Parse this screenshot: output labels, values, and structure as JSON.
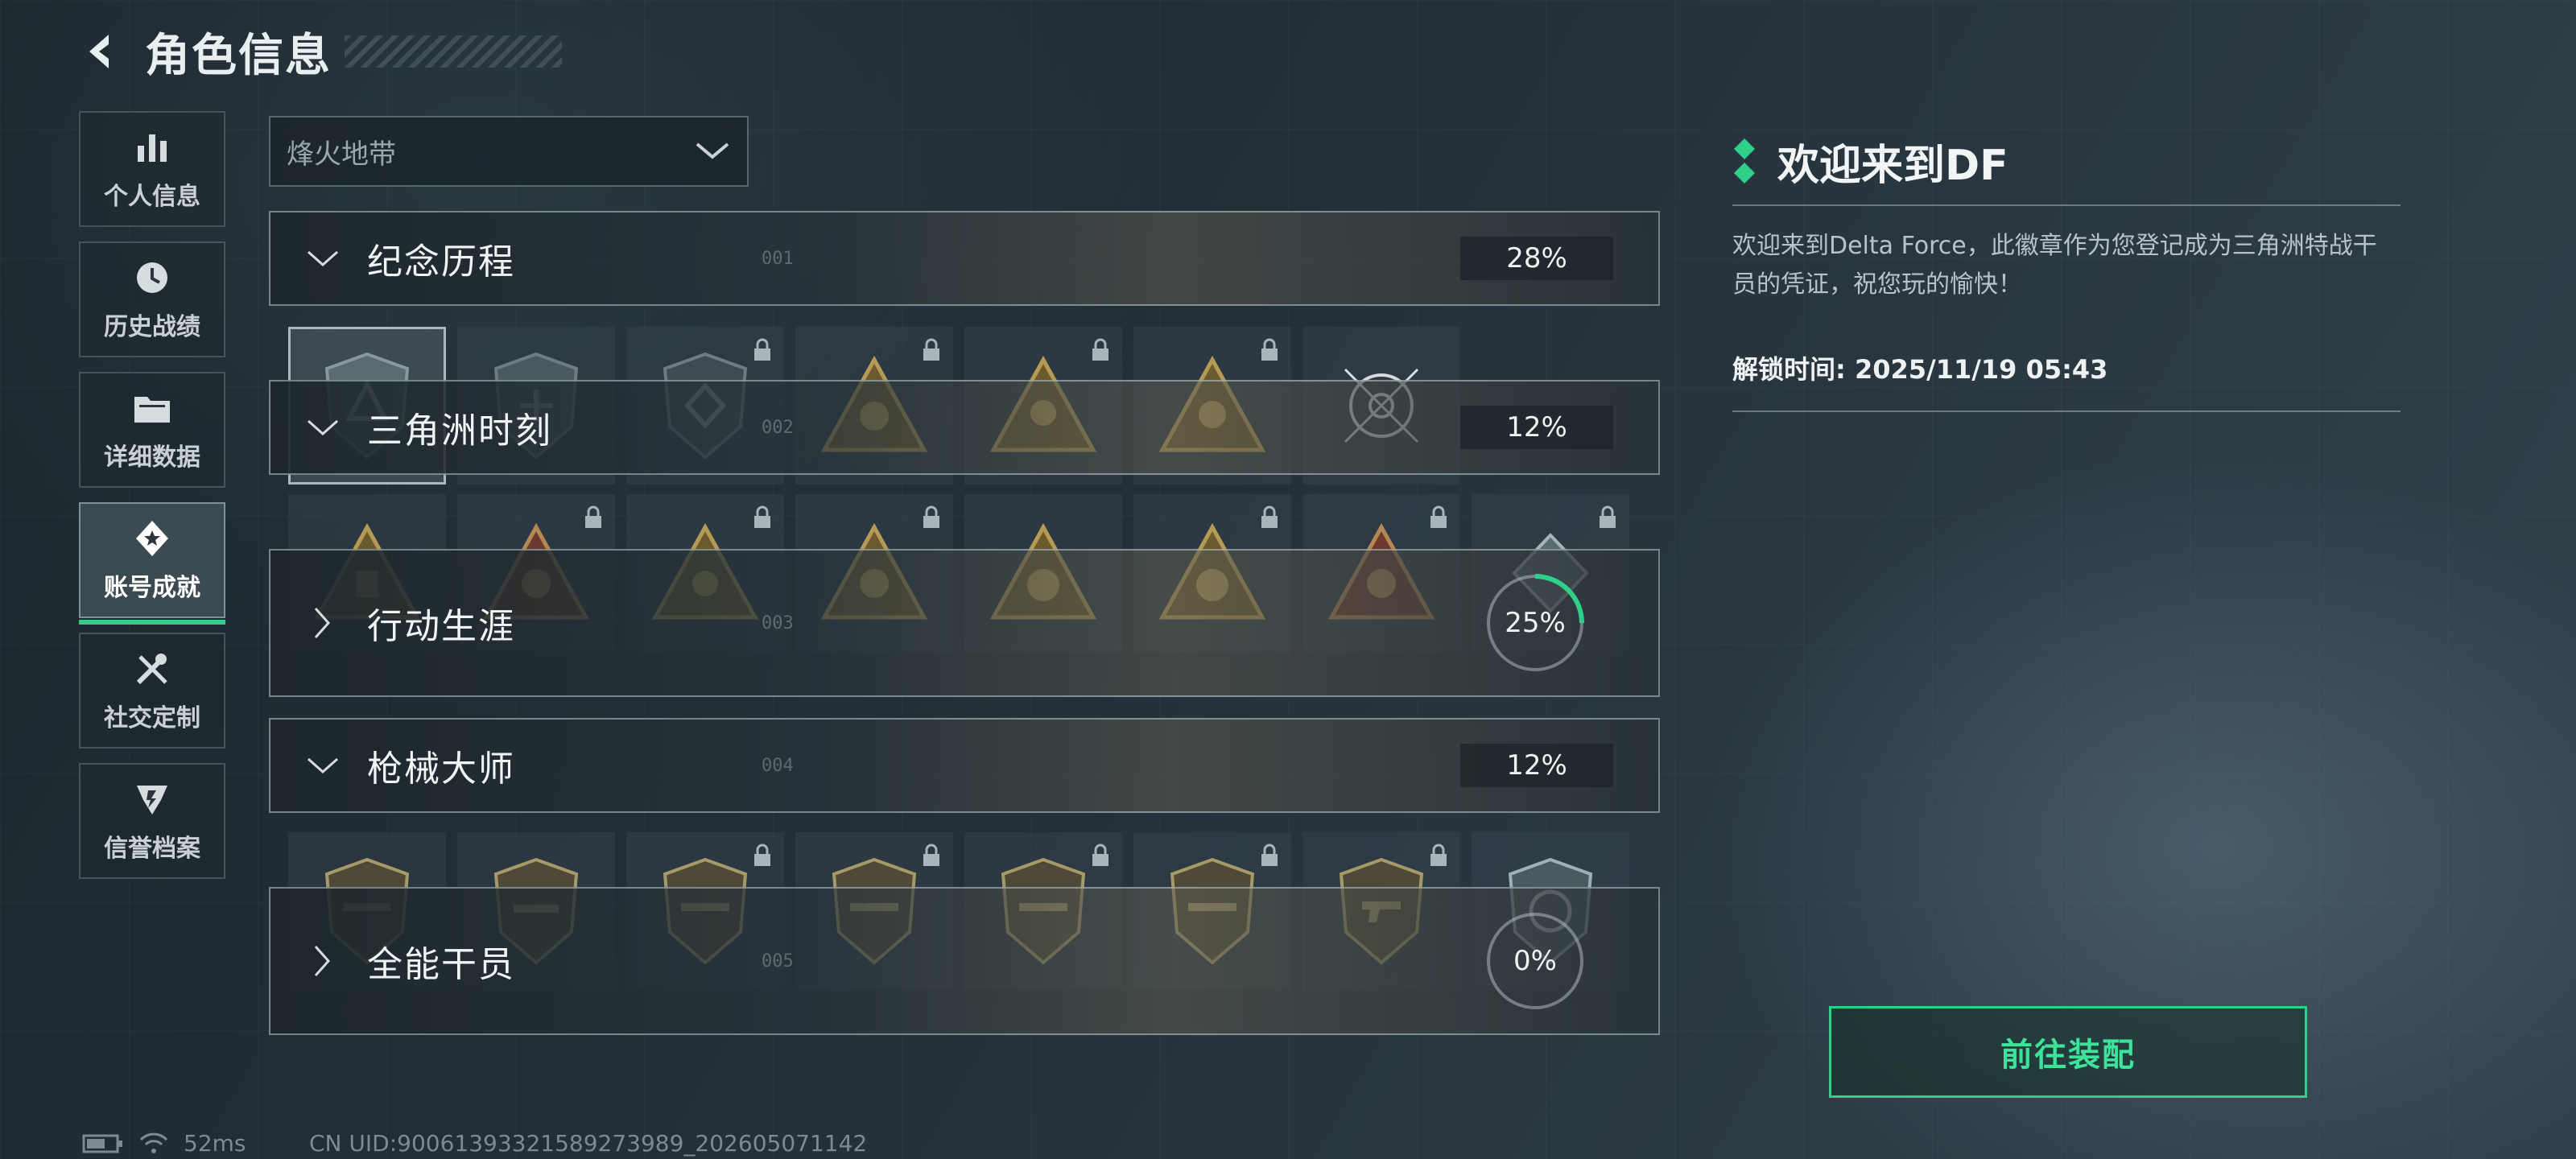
{
  "header": {
    "title": "角色信息"
  },
  "sidebar": {
    "items": [
      {
        "label": "个人信息",
        "icon": "bar-chart-icon",
        "active": false
      },
      {
        "label": "历史战绩",
        "icon": "history-clock-icon",
        "active": false
      },
      {
        "label": "详细数据",
        "icon": "folder-icon",
        "active": false
      },
      {
        "label": "账号成就",
        "icon": "achievement-icon",
        "active": true
      },
      {
        "label": "社交定制",
        "icon": "tools-icon",
        "active": false
      },
      {
        "label": "信誉档案",
        "icon": "credit-shield-icon",
        "active": false
      }
    ]
  },
  "mode_select": {
    "value": "烽火地带"
  },
  "categories": [
    {
      "title": "纪念历程",
      "number": "001",
      "percent": "28%",
      "expanded": true
    },
    {
      "title": "三角洲时刻",
      "number": "002",
      "percent": "12%",
      "expanded": true
    },
    {
      "title": "行动生涯",
      "number": "003",
      "percent": "25%",
      "progress": 0.25,
      "expanded": false
    },
    {
      "title": "枪械大师",
      "number": "004",
      "percent": "12%",
      "expanded": true
    },
    {
      "title": "全能干员",
      "number": "005",
      "percent": "0%",
      "progress": 0,
      "expanded": false
    }
  ],
  "detail": {
    "title": "欢迎来到DF",
    "description": "欢迎来到Delta Force，此徽章作为您登记成为三角洲特战干员的凭证，祝您玩的愉快！",
    "unlock_time": "解锁时间: 2025/11/19 05:43",
    "equip_label": "前往装配"
  },
  "status": {
    "ping": "52ms",
    "uid": "CN UID:9006139332158927398​9_202605071142"
  },
  "colors": {
    "accent": "#2fd18a",
    "background": "#243039"
  }
}
